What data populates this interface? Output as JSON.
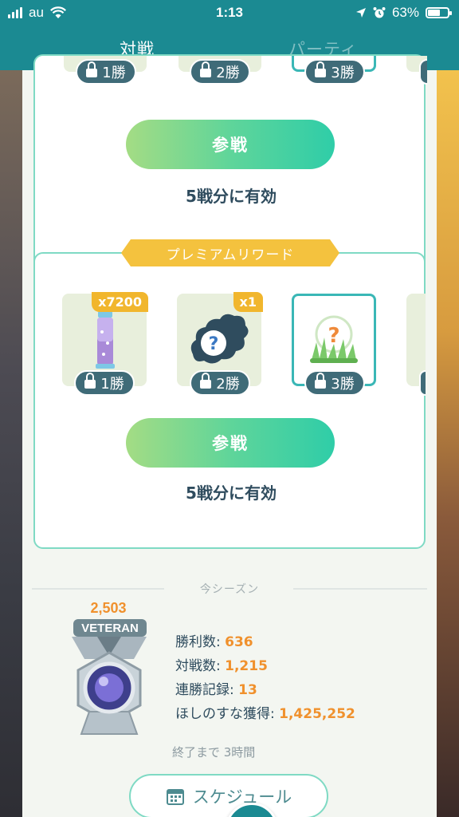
{
  "status_bar": {
    "carrier": "au",
    "time": "1:13",
    "battery_percent": "63%",
    "battery_level": 0.63
  },
  "tabs": [
    {
      "label": "対戦",
      "active": true
    },
    {
      "label": "パーティ",
      "active": false
    }
  ],
  "free_rewards": {
    "locks": [
      {
        "label": "1勝"
      },
      {
        "label": "2勝"
      },
      {
        "label": "3勝"
      }
    ],
    "join_button": "参戦",
    "valid_text": "5戦分に有効"
  },
  "premium_rewards": {
    "banner": "プレミアムリワード",
    "items": [
      {
        "icon": "incense-icon",
        "quantity": "x7200",
        "lock_label": "1勝"
      },
      {
        "icon": "mystery-item-icon",
        "quantity": "x1",
        "lock_label": "2勝"
      },
      {
        "icon": "mystery-encounter-icon",
        "quantity": "",
        "lock_label": "3勝"
      }
    ],
    "join_button": "参戦",
    "valid_text": "5戦分に有効"
  },
  "season": {
    "header": "今シーズン",
    "rating": "2,503",
    "rank": "VETERAN",
    "stats": [
      {
        "label": "勝利数: ",
        "value": "636"
      },
      {
        "label": "対戦数: ",
        "value": "1,215"
      },
      {
        "label": "連勝記録: ",
        "value": "13"
      },
      {
        "label": "ほしのすな獲得: ",
        "value": "1,425,252"
      }
    ],
    "ends_text": "終了まで 3時間"
  },
  "schedule_button": "スケジュール",
  "colors": {
    "header": "#1b8a92",
    "accent_orange": "#f0912d",
    "premium_gold": "#f4c23e",
    "card_border": "#7fdac4"
  }
}
